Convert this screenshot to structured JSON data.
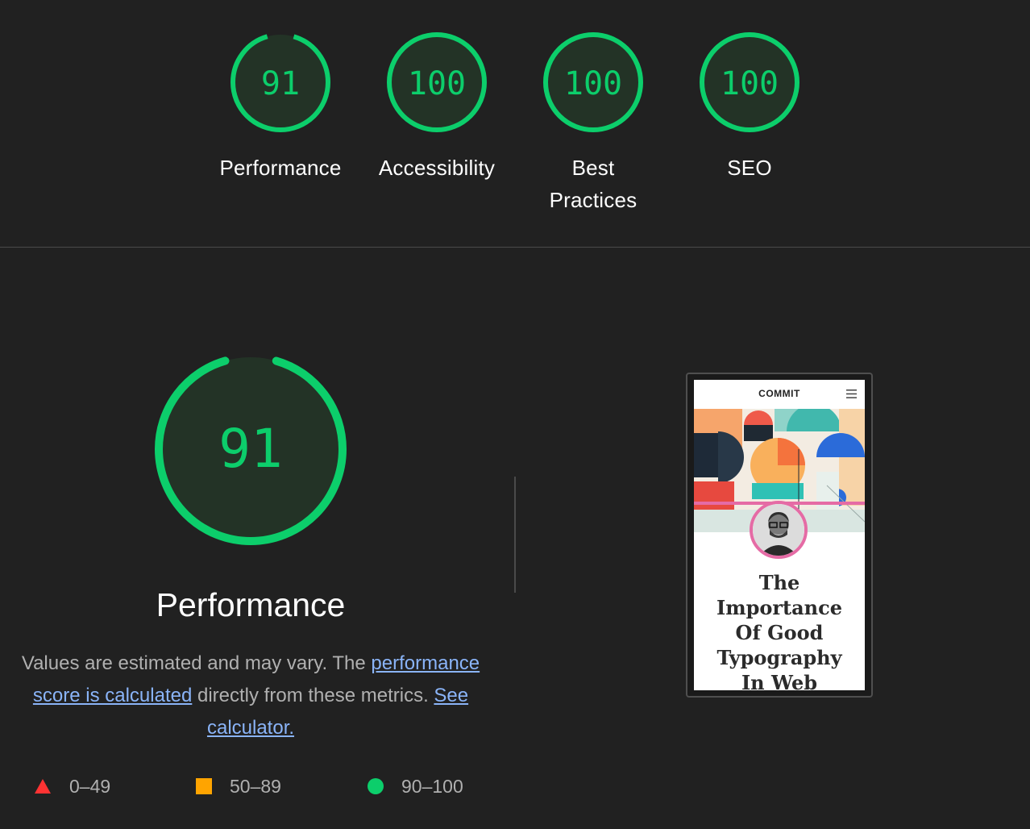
{
  "summary": {
    "gauges": [
      {
        "score": "91",
        "label": "Performance",
        "fraction": 0.91
      },
      {
        "score": "100",
        "label": "Accessibility",
        "fraction": 1.0
      },
      {
        "score": "100",
        "label_line1": "Best",
        "label_line2": "Practices",
        "fraction": 1.0
      },
      {
        "score": "100",
        "label": "SEO",
        "fraction": 1.0
      }
    ]
  },
  "performance": {
    "score": "91",
    "fraction": 0.91,
    "title": "Performance",
    "desc_prefix": "Values are estimated and may vary. The ",
    "link_score": "performance score is calculated",
    "desc_middle": " directly from these metrics. ",
    "link_calc": "See calculator."
  },
  "legend": {
    "fail": "0–49",
    "average": "50–89",
    "pass": "90–100"
  },
  "screenshot": {
    "logo": "COMMIT",
    "post_title_lines": [
      "The",
      "Importance",
      "Of Good",
      "Typography",
      "In Web"
    ]
  },
  "colors": {
    "pass": "#0cce6b",
    "gauge_fill": "#233326",
    "fail": "#ff3333",
    "average": "#ffa400",
    "link": "#8ab4f8",
    "background": "#212121",
    "accent_pink": "#e56ba5"
  },
  "icons": {
    "fail": "red-triangle-icon",
    "average": "orange-square-icon",
    "pass": "green-circle-icon",
    "menu": "hamburger-menu-icon"
  }
}
